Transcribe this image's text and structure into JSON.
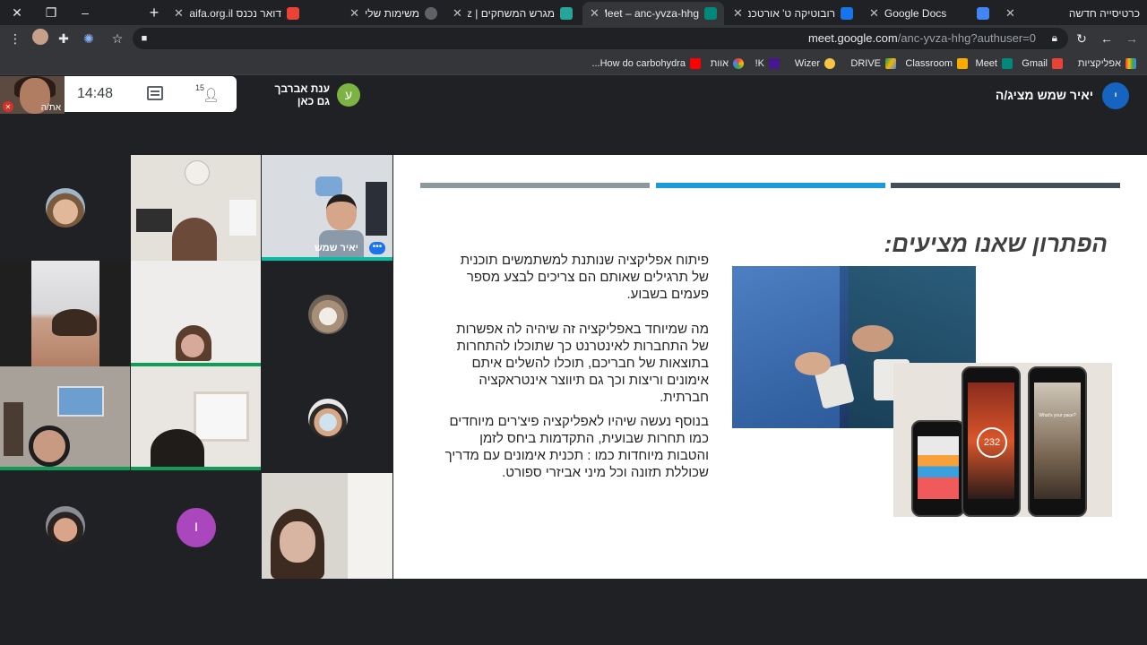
{
  "browser": {
    "tabs": [
      {
        "label": "כרטיסייה חדשה",
        "active": false
      },
      {
        "label": "Google Docs",
        "active": false
      },
      {
        "label": "רובוטיקה ט' אורטכנון רבין",
        "active": false
      },
      {
        "label": "Meet – anc-yvza-hhg",
        "active": true
      },
      {
        "label": "מגרש המשחקים | Skillz",
        "active": false
      },
      {
        "label": "משימות שלי",
        "active": false
      },
      {
        "label": "דואר נכנס haifa.org.il",
        "active": false
      }
    ],
    "url_host": "meet.google.com",
    "url_path": "/anc-yvza-hhg?authuser=0",
    "bookmarks": [
      "אפליקציות",
      "Gmail",
      "Meet",
      "Classroom",
      "DRIVE",
      "Wizer",
      "K!",
      "אוות",
      "How do carbohydra..."
    ]
  },
  "meet": {
    "self_name": "את/ה",
    "clock": "14:48",
    "participants_count": "15",
    "chip_name": "ענת אברבך",
    "chip_status": "גם כאן",
    "chip_initial": "ע",
    "presenting_text": "יאיר שמש מציג/ה",
    "presenter_initial": "י",
    "tile_name_yair": "יאיר שמש",
    "tile_initial": "ו"
  },
  "slide": {
    "title": "הפתרון שאנו מציעים:",
    "paragraph1": "פיתוח אפליקציה שנותנת למשתמשים תוכנית של תרגילים שאותם הם צריכים לבצע מספר פעמים בשבוע.",
    "paragraph2": "מה שמיוחד באפליקציה זה שיהיה לה אפשרות של התחברות לאינטרנט כך שתוכלו להתחרות בתוצאות של חבריכם, תוכלו להשלים איתם אימונים וריצות וכך גם תיווצר אינטראקציה חברתית.",
    "paragraph3": "בנוסף נעשה שיהיו לאפליקציה פיצ'רים מיוחדים כמו תחרות שבועית, התקדמות ביחס לזמן והטבות מיוחדות כמו : תכנית אימונים עם מדריך שכוללת תזונה וכל מיני אביזרי ספורט.",
    "phone_metric": "232",
    "phone_caption": "What's your pace?"
  },
  "colors": {
    "bar1": "#415058",
    "bar2": "#1b9bd8",
    "bar3": "#8d989d",
    "meet_bg": "#202124",
    "chip_avatar": "#7cb342",
    "presenter_avatar": "#1565c0",
    "purple_avatar": "#ab47bc"
  },
  "icons": [
    "close-icon",
    "restore-icon",
    "minimize-icon",
    "new-tab-icon",
    "menu-icon",
    "extensions-icon",
    "star-icon",
    "reload-icon",
    "back-icon",
    "forward-icon",
    "lock-icon",
    "chat-icon",
    "people-icon",
    "mic-off-icon",
    "more-options-icon"
  ]
}
